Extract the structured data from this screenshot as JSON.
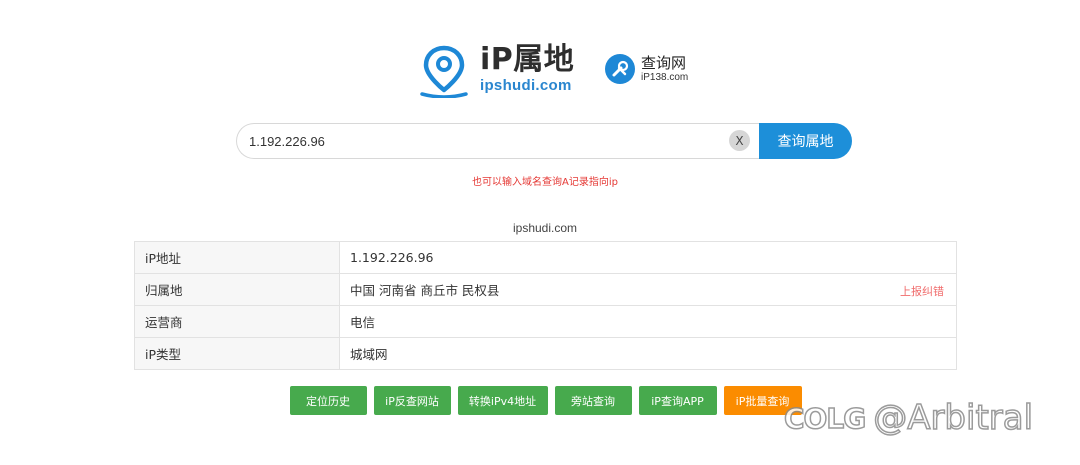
{
  "header": {
    "brand_title": "iP属地",
    "brand_domain": "ipshudi.com",
    "partner_name": "查询网",
    "partner_domain": "iP138.com",
    "brand_icon": "location-pin-icon",
    "partner_icon": "wrench-tools-icon"
  },
  "search": {
    "value": "1.192.226.96",
    "clear_label": "X",
    "button_label": "查询属地",
    "hint": "也可以输入域名查询A记录指向ip"
  },
  "result": {
    "domain": "ipshudi.com",
    "rows": [
      {
        "label": "iP地址",
        "value": "1.192.226.96"
      },
      {
        "label": "归属地",
        "value": "中国 河南省 商丘市 民权县"
      },
      {
        "label": "运营商",
        "value": "电信"
      },
      {
        "label": "iP类型",
        "value": "城域网"
      }
    ],
    "report_label": "上报纠错"
  },
  "actions": [
    {
      "label": "定位历史"
    },
    {
      "label": "iP反查网站"
    },
    {
      "label": "转换iPv4地址"
    },
    {
      "label": "旁站查询"
    },
    {
      "label": "iP查询APP"
    },
    {
      "label": "iP批量查询"
    }
  ],
  "watermark": {
    "logo": "COLG",
    "text": "@Arbitral"
  },
  "colors": {
    "accent_blue": "#1d8fd9",
    "action_green": "#47aa4d",
    "action_orange": "#fb8c00",
    "hint_red": "#e53935"
  }
}
